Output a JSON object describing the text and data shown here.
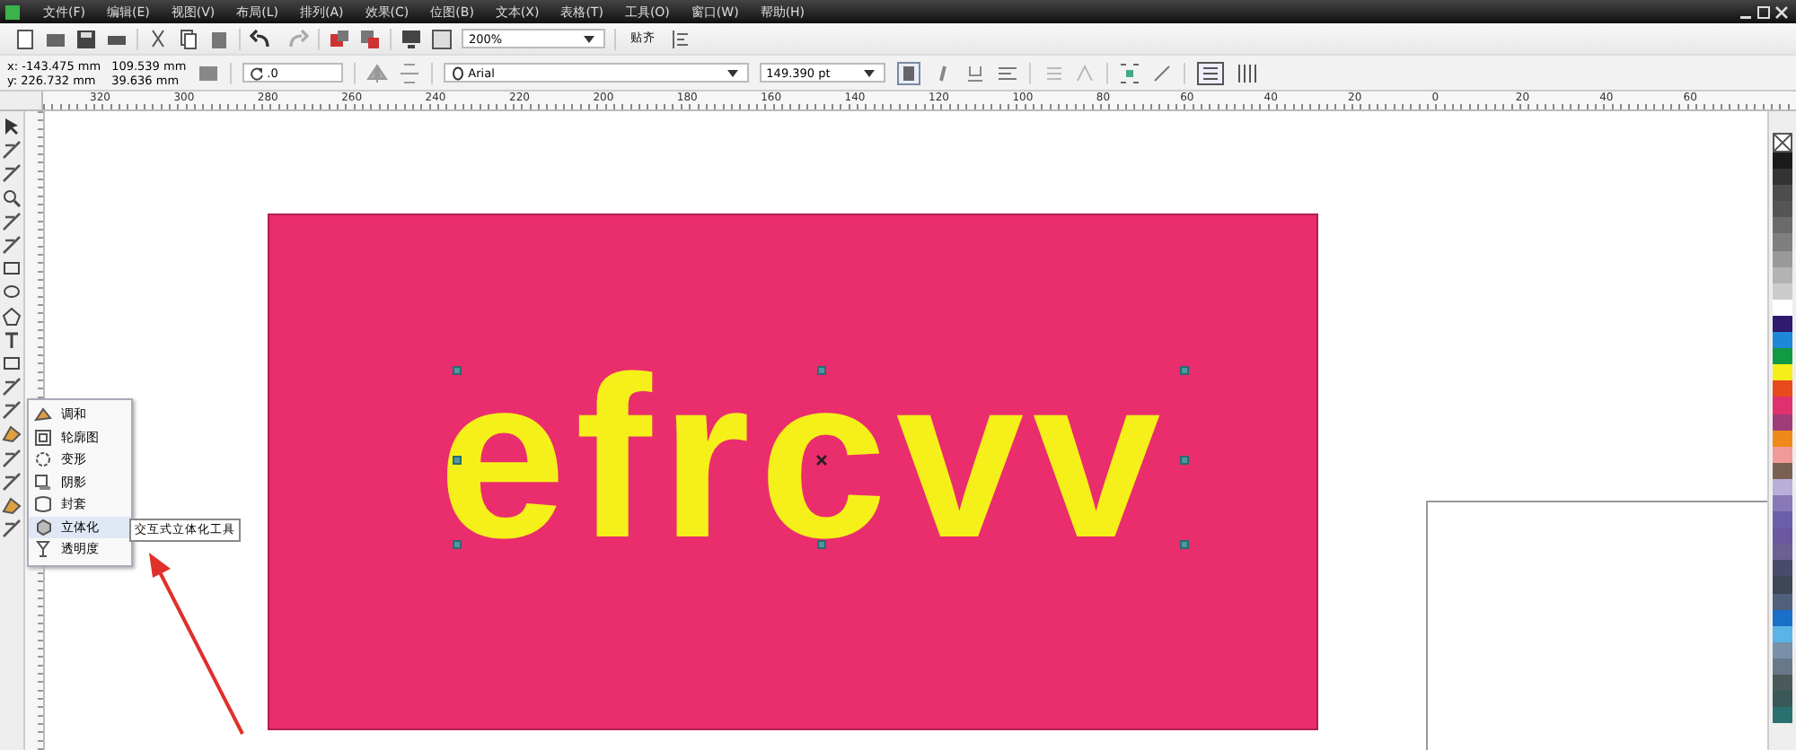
{
  "menu": [
    "文件(F)",
    "编辑(E)",
    "视图(V)",
    "布局(L)",
    "排列(A)",
    "效果(C)",
    "位图(B)",
    "文本(X)",
    "表格(T)",
    "工具(O)",
    "窗口(W)",
    "帮助(H)"
  ],
  "standard_toolbar": {
    "zoom": "200%",
    "snap": "贴齐"
  },
  "property_bar": {
    "x": "x: -143.475 mm",
    "y": "y: 226.732 mm",
    "width": "109.539 mm",
    "height": "39.636 mm",
    "rotation": ".0",
    "font": "Arial",
    "font_size": "149.390 pt"
  },
  "ruler": [
    "320",
    "300",
    "280",
    "260",
    "240",
    "220",
    "200",
    "180",
    "160",
    "140",
    "120",
    "100",
    "80",
    "60",
    "40",
    "20",
    "0",
    "20",
    "40",
    "60"
  ],
  "canvas": {
    "text": "efrcvv"
  },
  "flyout": [
    {
      "label": "调和",
      "selected": false
    },
    {
      "label": "轮廓图",
      "selected": false
    },
    {
      "label": "变形",
      "selected": false
    },
    {
      "label": "阴影",
      "selected": false
    },
    {
      "label": "封套",
      "selected": false
    },
    {
      "label": "立体化",
      "selected": true
    },
    {
      "label": "透明度",
      "selected": false
    }
  ],
  "tooltip": "交互式立体化工具",
  "palette": [
    {
      "color": "#1a1a1a"
    },
    {
      "color": "#333333"
    },
    {
      "color": "#4d4d4d"
    },
    {
      "color": "#555555"
    },
    {
      "color": "#6b6b6b"
    },
    {
      "color": "#7f7f7f"
    },
    {
      "color": "#999999"
    },
    {
      "color": "#b3b3b3"
    },
    {
      "color": "#cccccc"
    },
    {
      "color": "#ffffff"
    },
    {
      "color": "#2e1a6e"
    },
    {
      "color": "#1e88d8"
    },
    {
      "color": "#119944"
    },
    {
      "color": "#f5ee1a"
    },
    {
      "color": "#e84a1e"
    },
    {
      "color": "#e0306e"
    },
    {
      "color": "#a03c78"
    },
    {
      "color": "#ef8a1a"
    },
    {
      "color": "#f29a9a"
    },
    {
      "color": "#7a6050"
    },
    {
      "color": "#b8b0d8"
    },
    {
      "color": "#8878b8"
    },
    {
      "color": "#6a5fa8"
    },
    {
      "color": "#6a58a0"
    },
    {
      "color": "#6c6090"
    },
    {
      "color": "#4a4a6a"
    },
    {
      "color": "#3e4658"
    },
    {
      "color": "#50607a"
    },
    {
      "color": "#1a70c8"
    },
    {
      "color": "#5ab4e8"
    },
    {
      "color": "#7890a8"
    },
    {
      "color": "#687888"
    },
    {
      "color": "#4a5a5a"
    },
    {
      "color": "#3a5858"
    },
    {
      "color": "#2a7070"
    }
  ]
}
